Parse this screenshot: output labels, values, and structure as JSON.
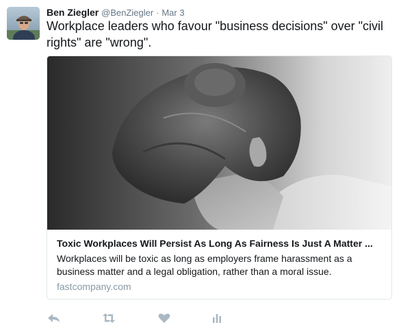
{
  "tweet": {
    "fullname": "Ben Ziegler",
    "username": "@BenZiegler",
    "separator": "·",
    "timestamp": "Mar 3",
    "text": "Workplace leaders who favour \"business decisions\" over \"civil rights\" are \"wrong\"."
  },
  "card": {
    "title": "Toxic Workplaces Will Persist As Long As Fairness Is Just A Matter ...",
    "description": "Workplaces will be toxic as long as employers frame harassment as a business matter and a legal obligation, rather than a moral issue.",
    "domain": "fastcompany.com"
  },
  "actions": [
    {
      "icon": "reply-icon"
    },
    {
      "icon": "retweet-icon"
    },
    {
      "icon": "like-icon"
    },
    {
      "icon": "analytics-icon"
    }
  ],
  "colors": {
    "text": "#14171a",
    "secondary": "#657786",
    "domain": "#8899a6",
    "border": "#e1e8ed",
    "action_icon": "#aab8c2"
  }
}
